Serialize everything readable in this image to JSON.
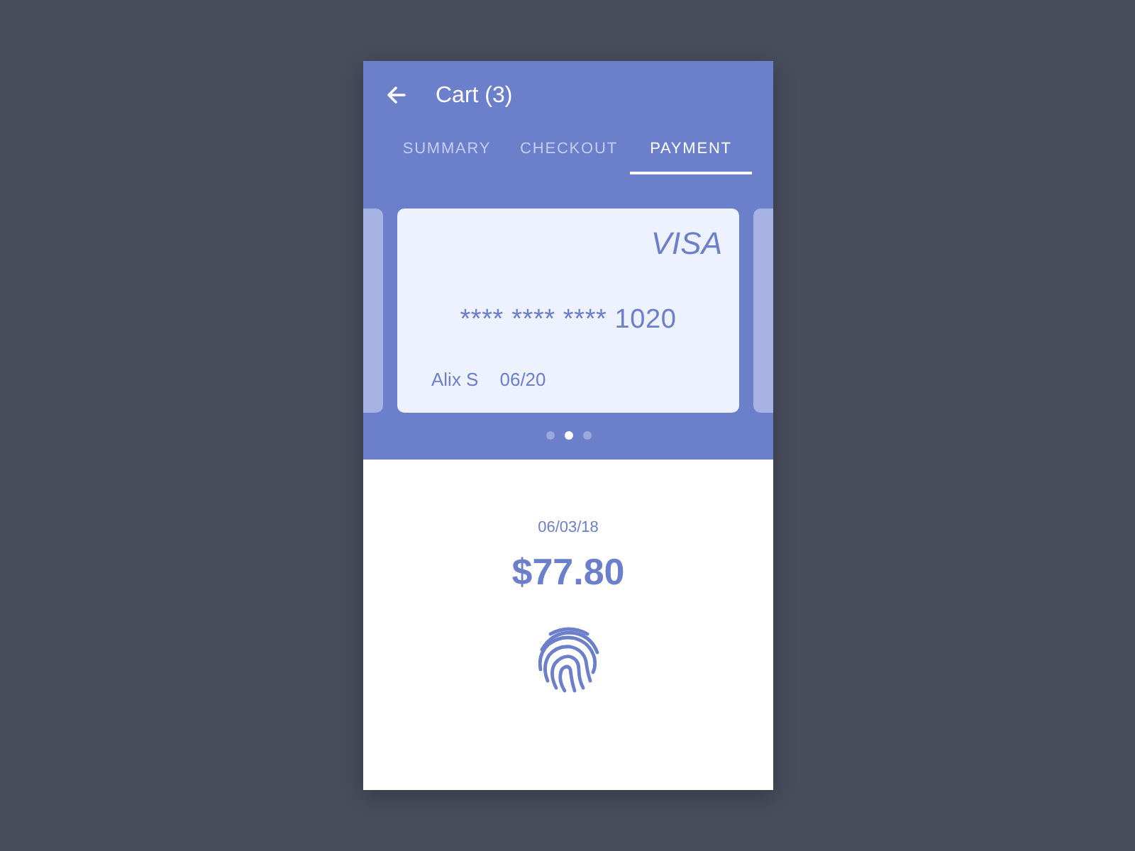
{
  "header": {
    "title": "Cart (3)"
  },
  "tabs": [
    {
      "label": "SUMMARY",
      "selected": false
    },
    {
      "label": "CHECKOUT",
      "selected": false
    },
    {
      "label": "PAYMENT",
      "selected": true
    }
  ],
  "card": {
    "brand": "VISA",
    "number": "**** **** **** 1020",
    "holder": "Alix S",
    "expiry": "06/20"
  },
  "carousel_dots": [
    {
      "selected": false
    },
    {
      "selected": true
    },
    {
      "selected": false
    }
  ],
  "payment": {
    "date": "06/03/18",
    "amount": "$77.80"
  }
}
